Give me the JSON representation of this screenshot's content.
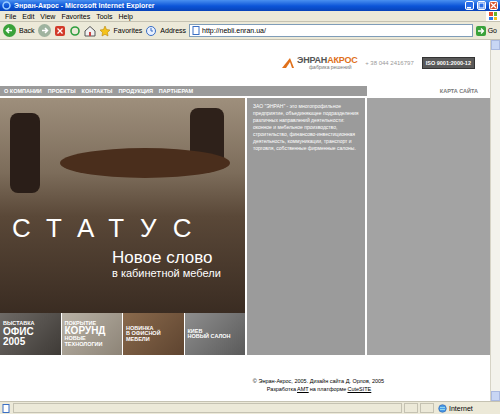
{
  "window": {
    "title": "Энран-Акрос - Microsoft Internet Explorer"
  },
  "menu": [
    "File",
    "Edit",
    "View",
    "Favorites",
    "Tools",
    "Help"
  ],
  "toolbar": {
    "back": "Back",
    "favorites": "Favorites",
    "address_label": "Address",
    "address": "http://nebli.enran.ua/",
    "go": "Go"
  },
  "site": {
    "logo": {
      "part1": "ЭНРАН",
      "part2": "АКРОС",
      "tagline": "фабрика решений"
    },
    "phone": "+ 38 044 2416797",
    "iso": "ISO 9001:2000-12",
    "nav": [
      "О КОМПАНИИ",
      "ПРОЕКТЫ",
      "КОНТАКТЫ",
      "ПРОДУКЦИЯ",
      "ПАРТНЕРАМ"
    ],
    "sitemap": "КАРТА САЙТА",
    "banner": {
      "title": "СТАТУС",
      "line1": "Новое слово",
      "line2": "в кабинетной мебели"
    },
    "about": "ЗАО \"ЭНРАН\" - это многопрофильное предприятие, объединяющее подразделения различных направлений деятельности: оконное и мебельное производство, строительство, финансово-инвестиционная деятельность, коммуникации, транспорт и торговля, собственные фирменные салоны.",
    "tiles": [
      {
        "lines": [
          {
            "text": "ВЫСТАВКА",
            "kind": "small"
          },
          {
            "text": "ОФИС",
            "kind": "big"
          },
          {
            "text": "2005",
            "kind": "big"
          }
        ]
      },
      {
        "lines": [
          {
            "text": "ПОКРЫТИЕ",
            "kind": "small"
          },
          {
            "text": "КОРУНД",
            "kind": "big"
          },
          {
            "text": "НОВЫЕ",
            "kind": "small"
          },
          {
            "text": "ТЕХНОЛОГИИ",
            "kind": "small"
          }
        ]
      },
      {
        "lines": [
          {
            "text": "НОВИНКА",
            "kind": "small"
          },
          {
            "text": "В ОФИСНОЙ",
            "kind": "small"
          },
          {
            "text": "МЕБЕЛИ",
            "kind": "small"
          }
        ]
      },
      {
        "lines": [
          {
            "text": "КИЕВ",
            "kind": "small"
          },
          {
            "text": "НОВЫЙ САЛОН",
            "kind": "small"
          }
        ]
      }
    ],
    "footer": {
      "line1": "© Энран-Акрос, 2005. Дизайн сайта Д. Орлов, 2005",
      "pre": "Разработка",
      "link1": "АМТ",
      "mid": "на платформе",
      "link2": "CuteSITE"
    }
  },
  "status_bar": {
    "zone": "Internet"
  }
}
